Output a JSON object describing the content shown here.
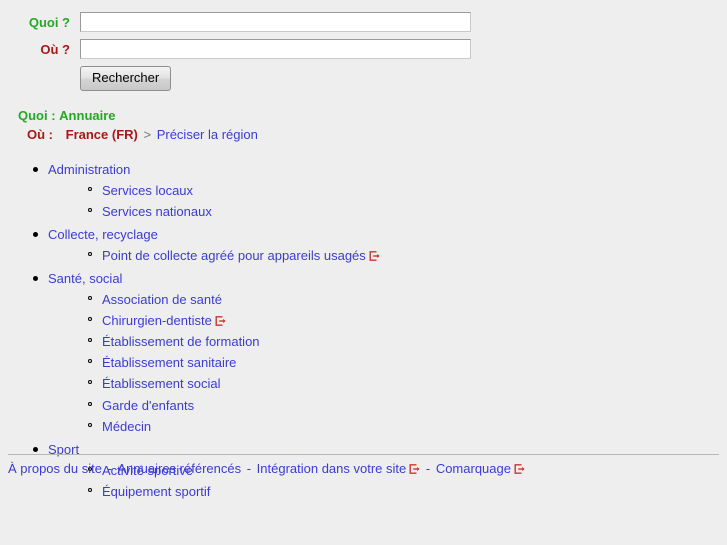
{
  "search": {
    "what_label": "Quoi ?",
    "where_label": "Où ?",
    "what_value": "",
    "where_value": "",
    "what_placeholder": "",
    "where_placeholder": "",
    "submit_label": "Rechercher"
  },
  "breadcrumb": {
    "what_prefix": "Quoi :",
    "what_value": "Annuaire",
    "where_prefix": "Où :",
    "where_value": "France (FR)",
    "separator": ">",
    "refine_label": "Préciser la région"
  },
  "categories": [
    {
      "label": "Administration",
      "external": false,
      "children": [
        {
          "label": "Services locaux",
          "external": false
        },
        {
          "label": "Services nationaux",
          "external": false
        }
      ]
    },
    {
      "label": "Collecte, recyclage",
      "external": false,
      "children": [
        {
          "label": "Point de collecte agréé pour appareils usagés",
          "external": true
        }
      ]
    },
    {
      "label": "Santé, social",
      "external": false,
      "children": [
        {
          "label": "Association de santé",
          "external": false
        },
        {
          "label": "Chirurgien-dentiste",
          "external": true
        },
        {
          "label": "Établissement de formation",
          "external": false
        },
        {
          "label": "Établissement sanitaire",
          "external": false
        },
        {
          "label": "Établissement social",
          "external": false
        },
        {
          "label": "Garde d'enfants",
          "external": false
        },
        {
          "label": "Médecin",
          "external": false
        }
      ]
    },
    {
      "label": "Sport",
      "external": false,
      "children": [
        {
          "label": "Activité sportive",
          "external": false
        },
        {
          "label": "Équipement sportif",
          "external": false
        }
      ]
    }
  ],
  "footer": {
    "separator": "-",
    "links": [
      {
        "label": "À propos du site",
        "external": false
      },
      {
        "label": "Annuaires référencés",
        "external": false
      },
      {
        "label": "Intégration dans votre site",
        "external": true
      },
      {
        "label": "Comarquage",
        "external": true
      }
    ]
  },
  "icons": {
    "external_link": "external-link-icon"
  },
  "colors": {
    "background": "#efeeee",
    "link": "#3b3bd4",
    "what": "#22aa22",
    "where": "#a81818",
    "external_icon": "#cc3333"
  }
}
